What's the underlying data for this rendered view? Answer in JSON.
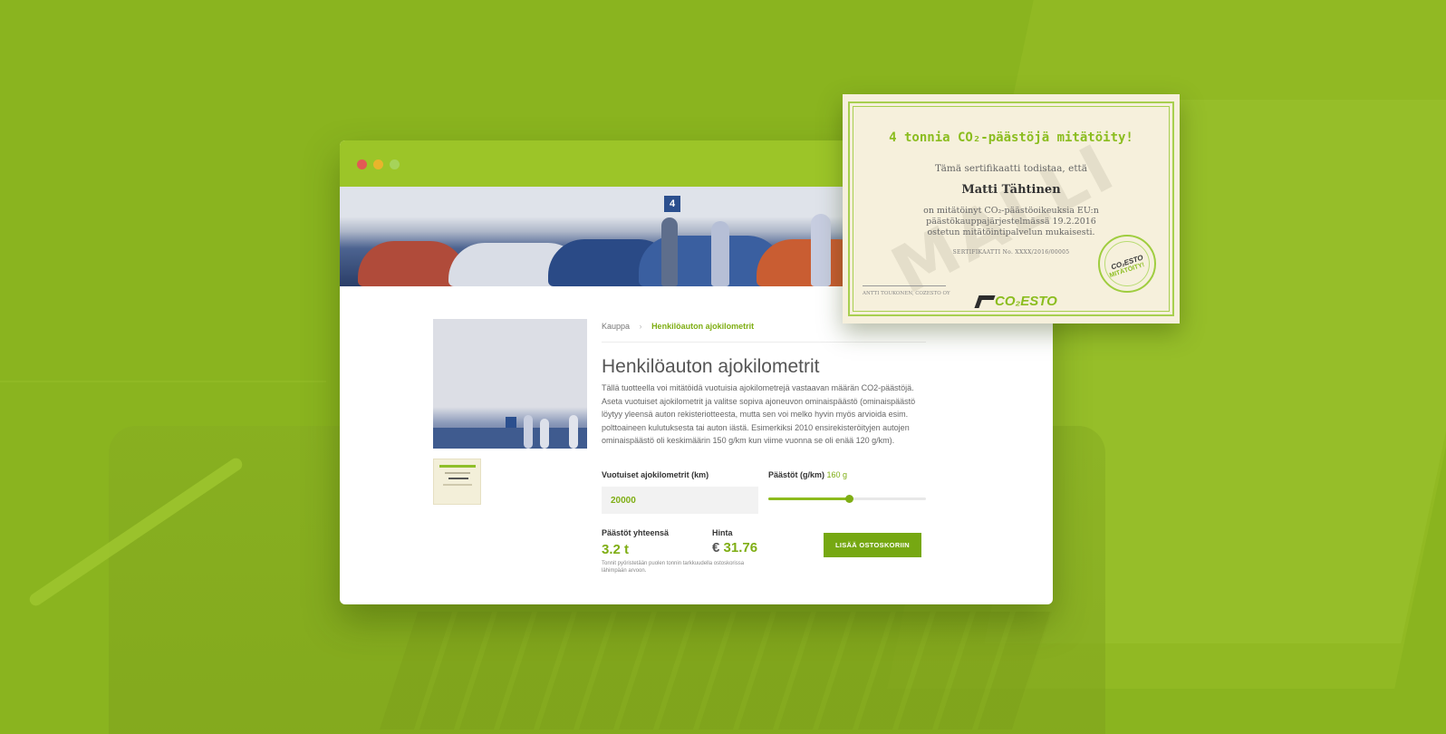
{
  "breadcrumb": {
    "home": "Kauppa",
    "separator": "›",
    "current": "Henkilöauton ajokilometrit"
  },
  "product": {
    "title": "Henkilöauton ajokilometrit",
    "description": "Tällä tuotteella voi mitätöidä vuotuisia ajokilometrejä vastaavan määrän CO2-päästöjä. Aseta vuotuiset ajokilometrit ja valitse sopiva ajoneuvon ominaispäästö (ominaispäästö löytyy yleensä auton rekisteriotteesta, mutta sen voi melko hyvin myös arvioida esim. polttoaineen kulutuksesta tai auton iästä. Esimerkiksi 2010 ensirekisteröityjen autojen ominaispäästö oli keskimäärin 150 g/km kun viime vuonna se oli enää 120 g/km)."
  },
  "form": {
    "km_label": "Vuotuiset ajokilometrit (km)",
    "km_value": "20000",
    "emissions_label": "Päästöt (g/km)",
    "emissions_value": "160 g",
    "slider_fraction": 0.51,
    "total_label": "Päästöt yhteensä",
    "total_value": "3.2 t",
    "price_label": "Hinta",
    "currency": "€",
    "price_value": "31.76",
    "rounding_note": "Tonnit pyöristetään puolen tonnin tarkkuudella ostoskorissa lähimpään arvoon.",
    "cart_button": "LISÄÄ OSTOSKORIIN"
  },
  "certificate": {
    "title": "4 tonnia CO₂-päästöjä mitätöity!",
    "intro": "Tämä sertifikaatti todistaa, että",
    "name": "Matti Tähtinen",
    "body": "on mitätöinyt CO₂-päästöoikeuksia EU:n päästökauppajärjestelmässä 19.2.2016 ostetun mitätöintipalvelun mukaisesti.",
    "number": "SERTIFIKAATTI No. XXXX/2016/00005",
    "signature": "ANTTI TOUKONEN, COZESTO OY",
    "watermark": "MALLI",
    "logo": "CO₂ESTO",
    "seal_top": "CO₂ESTO",
    "seal_bottom": "MITÄTÖITY!"
  },
  "colors": {
    "background": "#8ab41f",
    "accent": "#7fae14",
    "button": "#76a812",
    "browser_bar": "#9cc528"
  },
  "icons": [
    "window-close-dot",
    "window-minimize-dot",
    "window-maximize-dot"
  ]
}
